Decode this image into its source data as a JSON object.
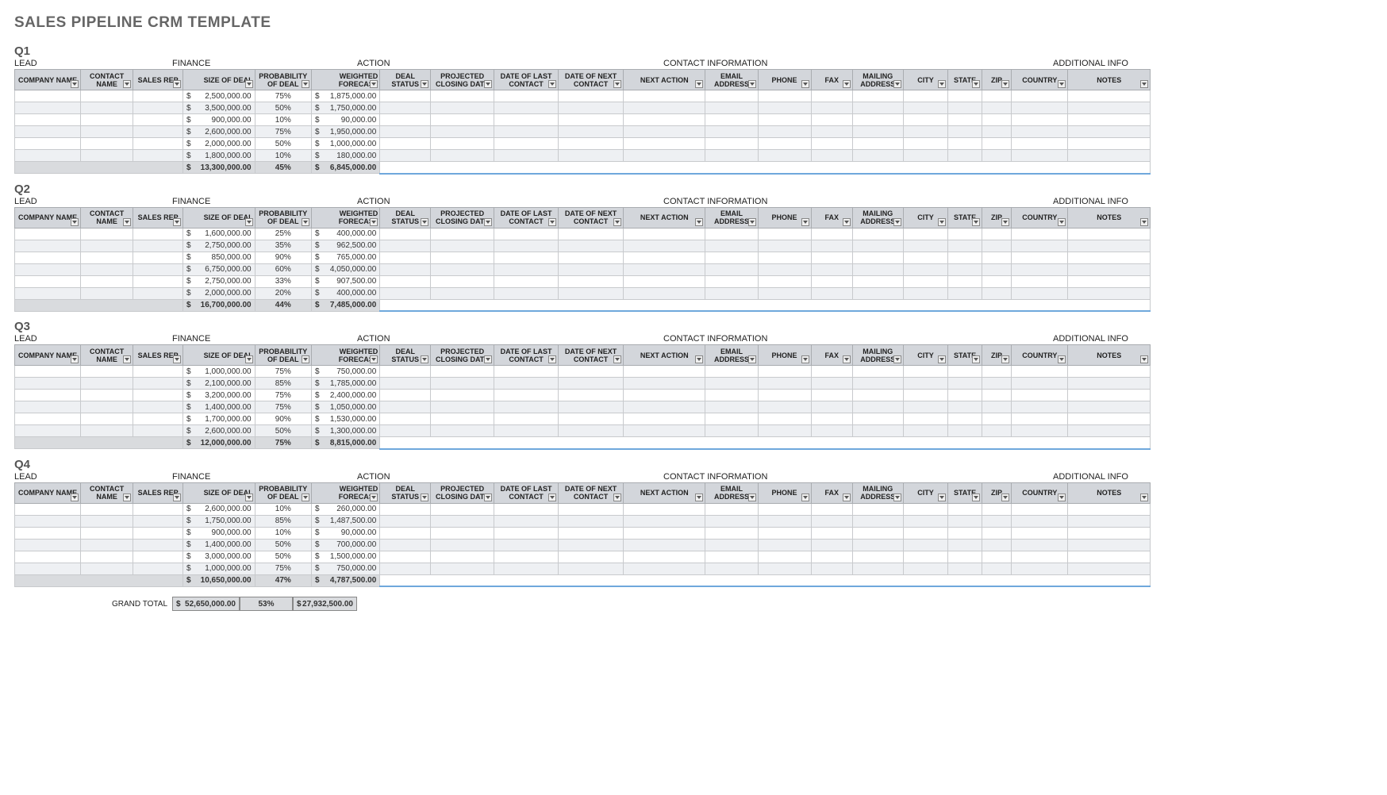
{
  "title": "SALES PIPELINE CRM TEMPLATE",
  "section_labels": {
    "lead": "LEAD",
    "finance": "FINANCE",
    "action": "ACTION",
    "contact": "CONTACT INFORMATION",
    "additional": "ADDITIONAL INFO"
  },
  "columns": [
    "COMPANY NAME",
    "CONTACT NAME",
    "SALES REP",
    "SIZE OF DEAL",
    "PROBABILITY OF DEAL",
    "WEIGHTED FORECAST",
    "DEAL STATUS",
    "PROJECTED CLOSING DATE",
    "DATE OF LAST CONTACT",
    "DATE OF NEXT CONTACT",
    "NEXT ACTION",
    "EMAIL ADDRESS",
    "PHONE",
    "FAX",
    "MAILING ADDRESS",
    "CITY",
    "STATE",
    "ZIP",
    "COUNTRY",
    "NOTES"
  ],
  "quarters": [
    {
      "label": "Q1",
      "rows": [
        {
          "size": "2,500,000.00",
          "prob": "75%",
          "weighted": "1,875,000.00"
        },
        {
          "size": "3,500,000.00",
          "prob": "50%",
          "weighted": "1,750,000.00"
        },
        {
          "size": "900,000.00",
          "prob": "10%",
          "weighted": "90,000.00"
        },
        {
          "size": "2,600,000.00",
          "prob": "75%",
          "weighted": "1,950,000.00"
        },
        {
          "size": "2,000,000.00",
          "prob": "50%",
          "weighted": "1,000,000.00"
        },
        {
          "size": "1,800,000.00",
          "prob": "10%",
          "weighted": "180,000.00"
        }
      ],
      "total": {
        "size": "13,300,000.00",
        "prob": "45%",
        "weighted": "6,845,000.00"
      }
    },
    {
      "label": "Q2",
      "rows": [
        {
          "size": "1,600,000.00",
          "prob": "25%",
          "weighted": "400,000.00"
        },
        {
          "size": "2,750,000.00",
          "prob": "35%",
          "weighted": "962,500.00"
        },
        {
          "size": "850,000.00",
          "prob": "90%",
          "weighted": "765,000.00"
        },
        {
          "size": "6,750,000.00",
          "prob": "60%",
          "weighted": "4,050,000.00"
        },
        {
          "size": "2,750,000.00",
          "prob": "33%",
          "weighted": "907,500.00"
        },
        {
          "size": "2,000,000.00",
          "prob": "20%",
          "weighted": "400,000.00"
        }
      ],
      "total": {
        "size": "16,700,000.00",
        "prob": "44%",
        "weighted": "7,485,000.00"
      }
    },
    {
      "label": "Q3",
      "rows": [
        {
          "size": "1,000,000.00",
          "prob": "75%",
          "weighted": "750,000.00"
        },
        {
          "size": "2,100,000.00",
          "prob": "85%",
          "weighted": "1,785,000.00"
        },
        {
          "size": "3,200,000.00",
          "prob": "75%",
          "weighted": "2,400,000.00"
        },
        {
          "size": "1,400,000.00",
          "prob": "75%",
          "weighted": "1,050,000.00"
        },
        {
          "size": "1,700,000.00",
          "prob": "90%",
          "weighted": "1,530,000.00"
        },
        {
          "size": "2,600,000.00",
          "prob": "50%",
          "weighted": "1,300,000.00"
        }
      ],
      "total": {
        "size": "12,000,000.00",
        "prob": "75%",
        "weighted": "8,815,000.00"
      }
    },
    {
      "label": "Q4",
      "rows": [
        {
          "size": "2,600,000.00",
          "prob": "10%",
          "weighted": "260,000.00"
        },
        {
          "size": "1,750,000.00",
          "prob": "85%",
          "weighted": "1,487,500.00"
        },
        {
          "size": "900,000.00",
          "prob": "10%",
          "weighted": "90,000.00"
        },
        {
          "size": "1,400,000.00",
          "prob": "50%",
          "weighted": "700,000.00"
        },
        {
          "size": "3,000,000.00",
          "prob": "50%",
          "weighted": "1,500,000.00"
        },
        {
          "size": "1,000,000.00",
          "prob": "75%",
          "weighted": "750,000.00"
        }
      ],
      "total": {
        "size": "10,650,000.00",
        "prob": "47%",
        "weighted": "4,787,500.00"
      }
    }
  ],
  "grand_total": {
    "label": "GRAND TOTAL",
    "size": "52,650,000.00",
    "prob": "53%",
    "weighted": "27,932,500.00"
  },
  "currency_symbol": "$"
}
